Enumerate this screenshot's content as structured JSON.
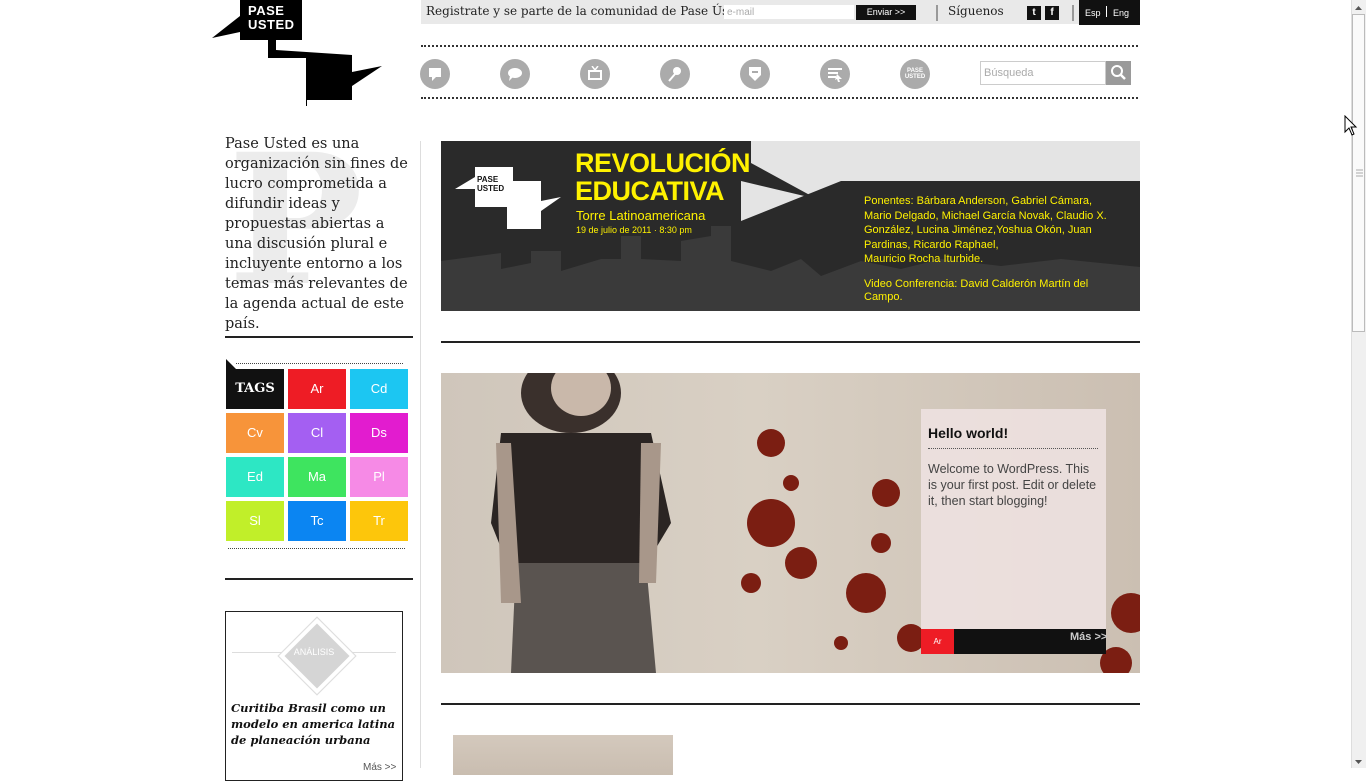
{
  "logo": {
    "text_line1": "PASE",
    "text_line2": "USTED"
  },
  "topbar": {
    "register_text": "Registrate y se parte de la comunidad de Pase Ústed",
    "email_placeholder": "e-mail",
    "send_label": "Enviar >>",
    "follow_label": "Síguenos",
    "twitter": "t",
    "facebook": "f",
    "lang_es": "Esp",
    "lang_en": "Eng"
  },
  "nav": {
    "icons": [
      "comments-icon",
      "chat-bubble-icon",
      "tv-icon",
      "microphone-icon",
      "badge-icon",
      "list-cursor-icon",
      "pase-usted-icon"
    ],
    "pase_line1": "PASE",
    "pase_line2": "USTED",
    "search_placeholder": "Búsqueda"
  },
  "sidebar": {
    "about": "Pase Usted es una organización sin fines de lucro comprometida a difundir ideas y propuestas abiertas a una discusión plural e incluyente entorno a los temas más relevantes de la agenda actual de este país.",
    "big_letter": "P",
    "tags_label": "TAGS",
    "tags": [
      {
        "label": "Ar",
        "color": "#ee1c25"
      },
      {
        "label": "Cd",
        "color": "#1cc6f2"
      },
      {
        "label": "Cv",
        "color": "#f7943a"
      },
      {
        "label": "Cl",
        "color": "#a45ff2"
      },
      {
        "label": "Ds",
        "color": "#e21ccf"
      },
      {
        "label": "Ed",
        "color": "#2de7c4"
      },
      {
        "label": "Ma",
        "color": "#3ee45f"
      },
      {
        "label": "Pl",
        "color": "#f68ae6"
      },
      {
        "label": "Sl",
        "color": "#c1ef29"
      },
      {
        "label": "Tc",
        "color": "#0b85f2"
      },
      {
        "label": "Tr",
        "color": "#fdc60b"
      }
    ],
    "analisis": {
      "badge": "ANÁLISIS",
      "title": "Curitiba Brasil como un modelo en america latina de planeación urbana",
      "more": "Más >>"
    }
  },
  "banner": {
    "logo_line1": "PASE",
    "logo_line2": "USTED",
    "title_line1": "REVOLUCIÓN",
    "title_line2": "EDUCATIVA",
    "venue": "Torre Latinoamericana",
    "date": "19 de julio de 2011 · 8:30 pm",
    "speakers_label": "Ponentes:",
    "speakers_line1": " Bárbara Anderson, Gabriel Cámara,",
    "speakers_line2": "Mario Delgado, Michael García Novak, Claudio X.",
    "speakers_line3": "González, Lucina Jiménez,Yoshua Okón, Juan",
    "speakers_line4": "Pardinas, Ricardo Raphael,",
    "speakers_line5": "Mauricio Rocha Iturbide.",
    "video_line1": "Video Conferencia: David Calderón Martín del",
    "video_line2": "Campo."
  },
  "post": {
    "title": "Hello world!",
    "excerpt": "Welcome to WordPress. This is your first post. Edit or delete it, then start blogging!",
    "tag": "Ar",
    "more": "Más >>"
  }
}
